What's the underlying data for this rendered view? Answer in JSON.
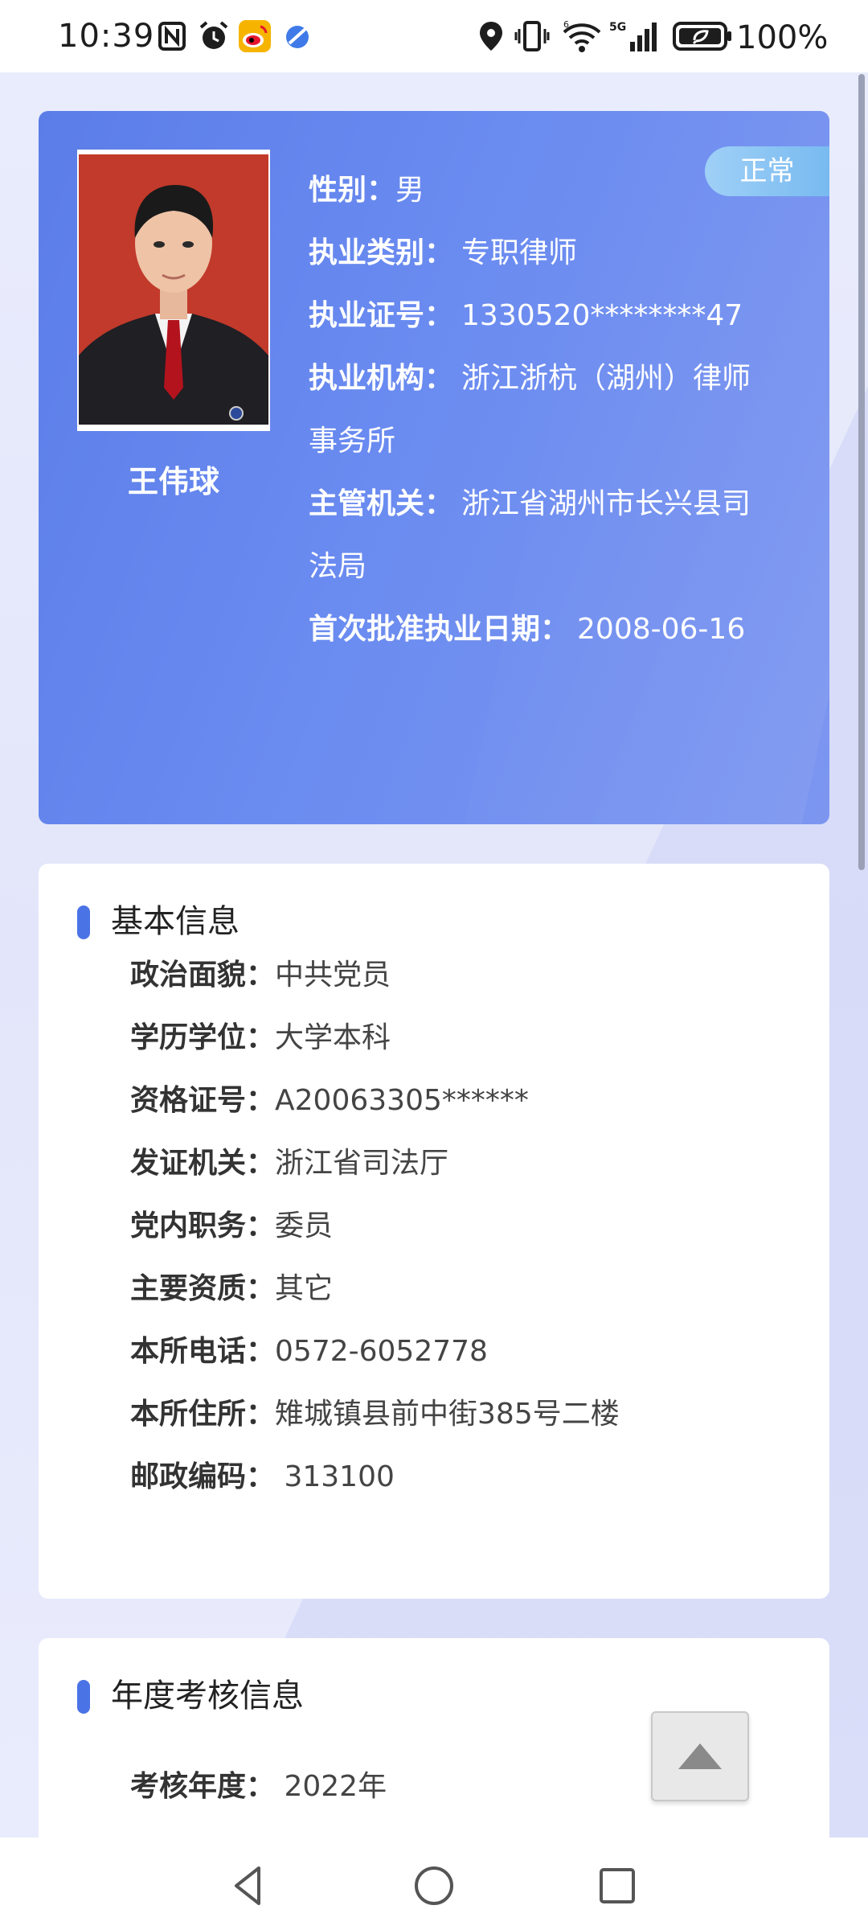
{
  "status_bar": {
    "time": "10:39",
    "battery": "100%",
    "icons": [
      "nfc-icon",
      "alarm-icon",
      "weibo-icon",
      "app-icon",
      "location-icon",
      "vibrate-icon",
      "wifi-icon",
      "signal-5g-icon",
      "battery-icon"
    ]
  },
  "profile": {
    "name": "王伟球",
    "status": "正常",
    "fields": [
      {
        "label": "性别：",
        "value": "男"
      },
      {
        "label": "执业类别：",
        "value": "专职律师"
      },
      {
        "label": "执业证号：",
        "value": "1330520********47"
      },
      {
        "label": "执业机构：",
        "value": "浙江浙杭（湖州）律师事务所"
      },
      {
        "label": "主管机关：",
        "value": "浙江省湖州市长兴县司法局"
      },
      {
        "label": "首次批准执业日期：",
        "value": "2008-06-16"
      }
    ]
  },
  "basic_info": {
    "title": "基本信息",
    "rows": [
      {
        "label": "政治面貌：",
        "value": "中共党员"
      },
      {
        "label": "学历学位：",
        "value": "大学本科"
      },
      {
        "label": "资格证号：",
        "value": "A20063305******"
      },
      {
        "label": "发证机关：",
        "value": "浙江省司法厅"
      },
      {
        "label": "党内职务：",
        "value": "委员"
      },
      {
        "label": "主要资质：",
        "value": "其它"
      },
      {
        "label": "本所电话：",
        "value": "0572-6052778"
      },
      {
        "label": "本所住所：",
        "value": "雉城镇县前中街385号二楼"
      },
      {
        "label": "邮政编码：",
        "value": " 313100"
      }
    ]
  },
  "annual_info": {
    "title": "年度考核信息",
    "rows": [
      {
        "label": "考核年度：",
        "value": " 2022年"
      }
    ]
  },
  "nav": {
    "icons": [
      "back-icon",
      "home-icon",
      "recents-icon"
    ]
  }
}
